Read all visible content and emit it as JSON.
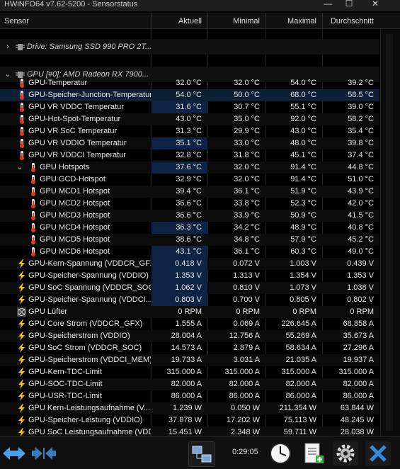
{
  "window": {
    "title": "HWiNFO64 v7.62-5200 - Sensorstatus"
  },
  "columns": {
    "sensor": "Sensor",
    "current": "Aktuell",
    "min": "Minimal",
    "max": "Maximal",
    "avg": "Durchschnitt"
  },
  "sections": [
    {
      "label": "Drive: Samsung SSD 990 PRO 2T...",
      "expanded": false
    },
    {
      "label": "GPU [#0]: AMD Radeon RX 7900...",
      "expanded": true
    }
  ],
  "rows": [
    {
      "icon": "thermometer-icon",
      "indent": 0,
      "name": "GPU-Temperatur",
      "cur": "32.0 °C",
      "min": "32.0 °C",
      "max": "54.0 °C",
      "avg": "39.2 °C"
    },
    {
      "icon": "thermometer-icon",
      "indent": 0,
      "name": "GPU-Speicher-Junction-Temperatur",
      "cur": "54.0 °C",
      "min": "50.0 °C",
      "max": "68.0 °C",
      "avg": "58.5 °C"
    },
    {
      "icon": "thermometer-icon",
      "indent": 0,
      "name": "GPU VR VDDC Temperatur",
      "cur": "31.6 °C",
      "min": "30.7 °C",
      "max": "55.1 °C",
      "avg": "39.0 °C"
    },
    {
      "icon": "thermometer-icon",
      "indent": 0,
      "name": "GPU-Hot-Spot-Temperatur",
      "cur": "43.0 °C",
      "min": "35.0 °C",
      "max": "92.0 °C",
      "avg": "58.2 °C"
    },
    {
      "icon": "thermometer-icon",
      "indent": 0,
      "name": "GPU VR SoC Temperatur",
      "cur": "31.3 °C",
      "min": "29.9 °C",
      "max": "43.0 °C",
      "avg": "35.4 °C"
    },
    {
      "icon": "thermometer-icon",
      "indent": 0,
      "name": "GPU VR VDDIO Temperatur",
      "cur": "35.1 °C",
      "min": "33.0 °C",
      "max": "48.0 °C",
      "avg": "39.8 °C"
    },
    {
      "icon": "thermometer-icon",
      "indent": 0,
      "name": "GPU VR VDDCI Temperatur",
      "cur": "32.8 °C",
      "min": "31.8 °C",
      "max": "45.1 °C",
      "avg": "37.4 °C"
    },
    {
      "icon": "thermometer-icon",
      "indent": 1,
      "name": "GPU Hotspots",
      "cur": "37.6 °C",
      "min": "32.0 °C",
      "max": "91.4 °C",
      "avg": "44.8 °C",
      "group": true
    },
    {
      "icon": "thermometer-icon",
      "indent": 2,
      "name": "GPU GCD-Hotspot",
      "cur": "32.9 °C",
      "min": "32.0 °C",
      "max": "91.4 °C",
      "avg": "51.0 °C"
    },
    {
      "icon": "thermometer-icon",
      "indent": 2,
      "name": "GPU MCD1 Hotspot",
      "cur": "39.4 °C",
      "min": "36.1 °C",
      "max": "51.9 °C",
      "avg": "43.9 °C"
    },
    {
      "icon": "thermometer-icon",
      "indent": 2,
      "name": "GPU MCD2 Hotspot",
      "cur": "36.6 °C",
      "min": "33.8 °C",
      "max": "52.3 °C",
      "avg": "42.0 °C"
    },
    {
      "icon": "thermometer-icon",
      "indent": 2,
      "name": "GPU MCD3 Hotspot",
      "cur": "36.6 °C",
      "min": "33.9 °C",
      "max": "50.9 °C",
      "avg": "41.5 °C"
    },
    {
      "icon": "thermometer-icon",
      "indent": 2,
      "name": "GPU MCD4 Hotspot",
      "cur": "36.3 °C",
      "min": "34.2 °C",
      "max": "48.9 °C",
      "avg": "40.8 °C"
    },
    {
      "icon": "thermometer-icon",
      "indent": 2,
      "name": "GPU MCD5 Hotspot",
      "cur": "38.6 °C",
      "min": "34.8 °C",
      "max": "57.9 °C",
      "avg": "45.2 °C"
    },
    {
      "icon": "thermometer-icon",
      "indent": 2,
      "name": "GPU MCD6 Hotspot",
      "cur": "43.1 °C",
      "min": "36.1 °C",
      "max": "60.3 °C",
      "avg": "49.0 °C"
    },
    {
      "icon": "lightning-icon",
      "indent": 0,
      "name": "GPU-Kern-Spannung (VDDCR_GFX)",
      "cur": "0.418 V",
      "min": "0.072 V",
      "max": "1.003 V",
      "avg": "0.439 V"
    },
    {
      "icon": "lightning-icon",
      "indent": 0,
      "name": "GPU-Speicher-Spannung (VDDIO)",
      "cur": "1.353 V",
      "min": "1.313 V",
      "max": "1.354 V",
      "avg": "1.353 V"
    },
    {
      "icon": "lightning-icon",
      "indent": 0,
      "name": "GPU SoC Spannung (VDDCR_SOC)",
      "cur": "1.062 V",
      "min": "0.810 V",
      "max": "1.073 V",
      "avg": "1.038 V"
    },
    {
      "icon": "lightning-icon",
      "indent": 0,
      "name": "GPU-Speicher-Spannung (VDDCI...",
      "cur": "0.803 V",
      "min": "0.700 V",
      "max": "0.805 V",
      "avg": "0.802 V"
    },
    {
      "icon": "fan-icon",
      "indent": 0,
      "name": "GPU Lüfter",
      "cur": "0 RPM",
      "min": "0 RPM",
      "max": "0 RPM",
      "avg": "0 RPM"
    },
    {
      "icon": "lightning-icon",
      "indent": 0,
      "name": "GPU Core Strom (VDDCR_GFX)",
      "cur": "1.555 A",
      "min": "0.069 A",
      "max": "226.645 A",
      "avg": "68.858 A"
    },
    {
      "icon": "lightning-icon",
      "indent": 0,
      "name": "GPU-Speicherstrom (VDDIO)",
      "cur": "28.004 A",
      "min": "12.756 A",
      "max": "55.269 A",
      "avg": "35.673 A"
    },
    {
      "icon": "lightning-icon",
      "indent": 0,
      "name": "GPU SoC Strom (VDDCR_SOC)",
      "cur": "14.573 A",
      "min": "2.879 A",
      "max": "58.634 A",
      "avg": "27.296 A"
    },
    {
      "icon": "lightning-icon",
      "indent": 0,
      "name": "GPU-Speicherstrom (VDDCI_MEM)",
      "cur": "19.733 A",
      "min": "3.031 A",
      "max": "21.035 A",
      "avg": "19.937 A"
    },
    {
      "icon": "lightning-icon",
      "indent": 0,
      "name": "GPU-Kern-TDC-Limit",
      "cur": "315.000 A",
      "min": "315.000 A",
      "max": "315.000 A",
      "avg": "315.000 A"
    },
    {
      "icon": "lightning-icon",
      "indent": 0,
      "name": "GPU-SOC-TDC-Limit",
      "cur": "82.000 A",
      "min": "82.000 A",
      "max": "82.000 A",
      "avg": "82.000 A"
    },
    {
      "icon": "lightning-icon",
      "indent": 0,
      "name": "GPU-USR-TDC-Limit",
      "cur": "86.000 A",
      "min": "86.000 A",
      "max": "86.000 A",
      "avg": "86.000 A"
    },
    {
      "icon": "lightning-icon",
      "indent": 0,
      "name": "GPU Kern-Leistungsaufnahme (V...",
      "cur": "1.239 W",
      "min": "0.050 W",
      "max": "211.354 W",
      "avg": "63.844 W"
    },
    {
      "icon": "lightning-icon",
      "indent": 0,
      "name": "GPU-Speicher-Leistung (VDDIO)",
      "cur": "37.878 W",
      "min": "17.202 W",
      "max": "75.113 W",
      "avg": "48.245 W"
    },
    {
      "icon": "lightning-icon",
      "indent": 0,
      "name": "GPU SoC Leistungsaufnahme (VDD...",
      "cur": "15.451 W",
      "min": "2.348 W",
      "max": "59.711 W",
      "avg": "28.038 W"
    }
  ],
  "toolbar": {
    "elapsed": "0:29:05"
  }
}
